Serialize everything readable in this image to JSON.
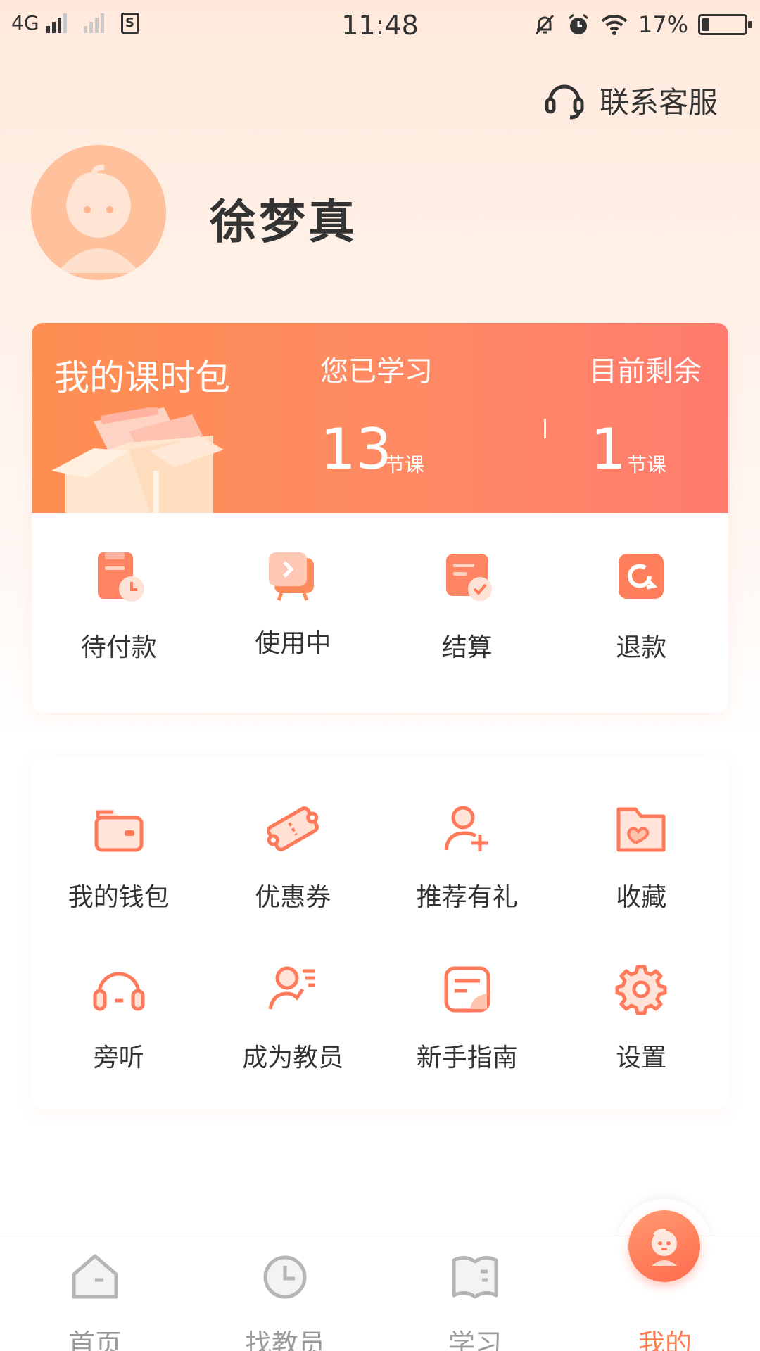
{
  "status_bar": {
    "network": "4G",
    "time": "11:48",
    "battery": "17%",
    "battery_level": 0.17
  },
  "header": {
    "service_label": "联系客服"
  },
  "profile": {
    "name": "徐梦真"
  },
  "package": {
    "title": "我的课时包",
    "learned_label": "您已学习",
    "learned_value": "13",
    "learned_unit": "节课",
    "remaining_label": "目前剩余",
    "remaining_value": "1",
    "remaining_unit": "节课",
    "actions": [
      {
        "label": "待付款",
        "icon": "pending-payment-icon"
      },
      {
        "label": "使用中",
        "icon": "in-use-icon"
      },
      {
        "label": "结算",
        "icon": "settlement-icon"
      },
      {
        "label": "退款",
        "icon": "refund-icon"
      }
    ]
  },
  "services": {
    "items": [
      {
        "label": "我的钱包",
        "icon": "wallet-icon"
      },
      {
        "label": "优惠券",
        "icon": "coupon-icon"
      },
      {
        "label": "推荐有礼",
        "icon": "add-user-icon"
      },
      {
        "label": "收藏",
        "icon": "favorites-folder-icon"
      },
      {
        "label": "旁听",
        "icon": "headphones-icon"
      },
      {
        "label": "成为教员",
        "icon": "become-teacher-icon"
      },
      {
        "label": "新手指南",
        "icon": "guide-icon"
      },
      {
        "label": "设置",
        "icon": "gear-icon"
      }
    ]
  },
  "tabbar": {
    "tabs": [
      {
        "label": "首页",
        "icon": "home-icon"
      },
      {
        "label": "找教员",
        "icon": "clock-icon"
      },
      {
        "label": "学习",
        "icon": "book-icon"
      },
      {
        "label": "我的",
        "icon": "profile-face-icon",
        "active": true
      }
    ]
  },
  "colors": {
    "accent": "#FF7A4D",
    "header_gradient_start": "#FF8E52",
    "header_gradient_end": "#FF7B6E",
    "inactive_tab": "#9A9A9A"
  }
}
